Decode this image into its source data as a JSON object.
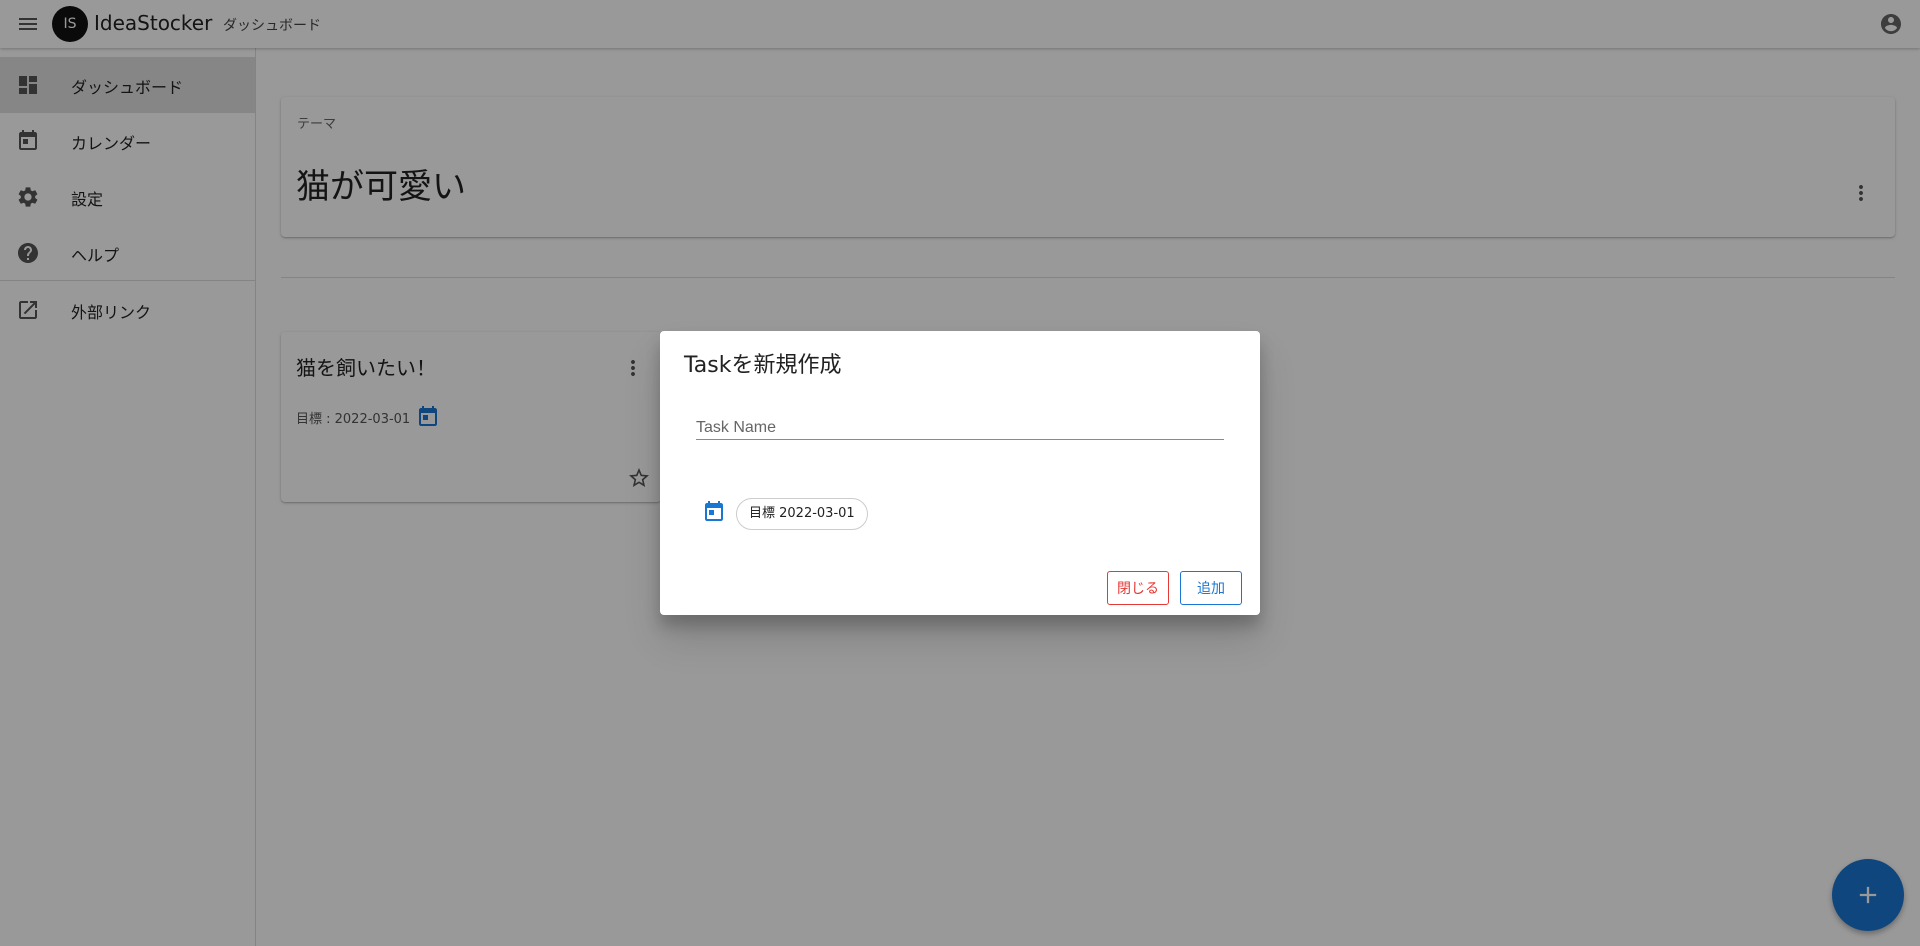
{
  "appbar": {
    "avatar_initials": "IS",
    "title": "IdeaStocker",
    "breadcrumb": "ダッシュボード"
  },
  "sidebar": {
    "items": [
      {
        "label": "ダッシュボード",
        "icon": "dashboard-icon",
        "active": true
      },
      {
        "label": "カレンダー",
        "icon": "calendar-icon"
      },
      {
        "label": "設定",
        "icon": "gear-icon"
      },
      {
        "label": "ヘルプ",
        "icon": "help-icon"
      },
      {
        "label": "外部リンク",
        "icon": "external-link-icon"
      }
    ]
  },
  "theme": {
    "overline": "テーマ",
    "title": "猫が可愛い"
  },
  "idea_card": {
    "title": "猫を飼いたい！",
    "goal": "目標 : 2022-03-01"
  },
  "dialog": {
    "title": "Taskを新規作成",
    "task_name_placeholder": "Task Name",
    "date_chip": "目標 2022-03-01",
    "close_label": "閉じる",
    "add_label": "追加"
  },
  "colors": {
    "primary": "#1976d2",
    "danger": "#e53935",
    "overlay": "rgba(0,0,0,0.4)"
  }
}
